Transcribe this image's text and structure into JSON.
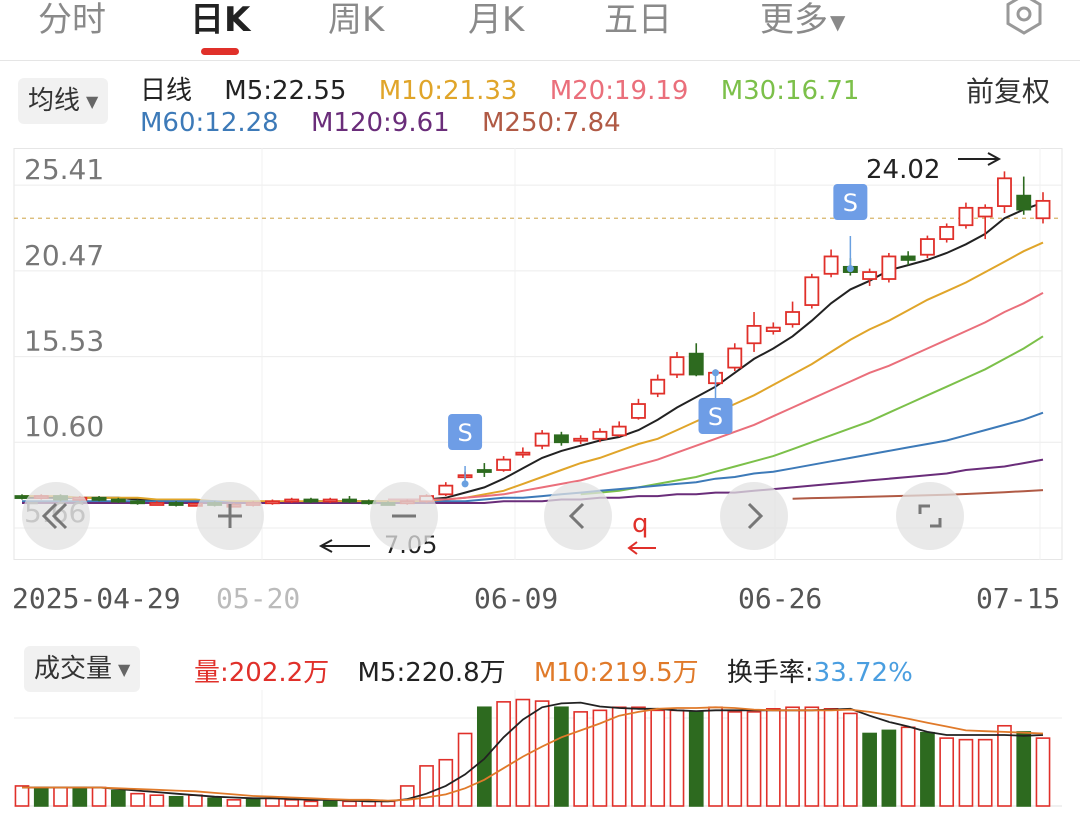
{
  "tabs": {
    "items": [
      {
        "label": "分时",
        "active": false
      },
      {
        "label": "日K",
        "active": true
      },
      {
        "label": "周K",
        "active": false
      },
      {
        "label": "月K",
        "active": false
      },
      {
        "label": "五日",
        "active": false
      },
      {
        "label": "更多",
        "active": false
      }
    ],
    "settings_icon": "gear-icon"
  },
  "ma_legend": {
    "dropdown": "均线",
    "period": "日线",
    "items": [
      {
        "label": "M5:22.55",
        "color": "#222222"
      },
      {
        "label": "M10:21.33",
        "color": "#e0a52a"
      },
      {
        "label": "M20:19.19",
        "color": "#ea6f7b"
      },
      {
        "label": "M30:16.71",
        "color": "#7cc04a"
      },
      {
        "label": "M60:12.28",
        "color": "#3d7ab8"
      },
      {
        "label": "M120:9.61",
        "color": "#6a2d7a"
      },
      {
        "label": "M250:7.84",
        "color": "#b05a45"
      }
    ],
    "adjust": "前复权"
  },
  "volume_legend": {
    "dropdown": "成交量",
    "volume_label": "量:202.2万",
    "m5_label": "M5:220.8万",
    "m10_label": "M10:219.5万",
    "turnover_label": "换手率:",
    "turnover_value": "33.72%"
  },
  "controls": [
    "rewind-icon",
    "zoom-in-icon",
    "zoom-out-icon",
    "previous-icon",
    "next-icon",
    "fullscreen-icon"
  ],
  "colors": {
    "up": "#e0302a",
    "down": "#2d6a1f",
    "accent": "#e0302a"
  },
  "chart_data": {
    "type": "candlestick",
    "ylim": [
      5.66,
      27.2
    ],
    "y_ticks": [
      "25.41",
      "20.47",
      "15.53",
      "10.60",
      "5.66"
    ],
    "x_ticks": [
      "2025-04-29",
      "05-20",
      "06-09",
      "06-26",
      "07-15"
    ],
    "max_label": "24.02",
    "min_label": "7.05",
    "markers": [
      "S",
      "S",
      "S"
    ],
    "candles": [
      [
        7.5,
        7.4,
        7.6,
        7.3
      ],
      [
        7.4,
        7.5,
        7.6,
        7.3
      ],
      [
        7.5,
        7.3,
        7.6,
        7.2
      ],
      [
        7.3,
        7.4,
        7.5,
        7.2
      ],
      [
        7.4,
        7.3,
        7.5,
        7.2
      ],
      [
        7.3,
        7.2,
        7.4,
        7.1
      ],
      [
        7.2,
        7.1,
        7.3,
        7.0
      ],
      [
        7.1,
        7.1,
        7.2,
        7.0
      ],
      [
        7.1,
        7.0,
        7.2,
        6.9
      ],
      [
        7.0,
        7.05,
        7.1,
        6.9
      ],
      [
        7.1,
        7.0,
        7.2,
        6.9
      ],
      [
        7.0,
        7.0,
        7.1,
        6.9
      ],
      [
        7.0,
        7.1,
        7.2,
        6.9
      ],
      [
        7.1,
        7.2,
        7.3,
        7.0
      ],
      [
        7.2,
        7.3,
        7.4,
        7.1
      ],
      [
        7.3,
        7.2,
        7.4,
        7.1
      ],
      [
        7.2,
        7.3,
        7.4,
        7.1
      ],
      [
        7.3,
        7.2,
        7.5,
        7.1
      ],
      [
        7.2,
        7.1,
        7.3,
        7.0
      ],
      [
        7.1,
        7.05,
        7.2,
        7.05
      ],
      [
        7.1,
        7.2,
        7.3,
        7.0
      ],
      [
        7.2,
        7.5,
        7.6,
        7.1
      ],
      [
        7.6,
        8.1,
        8.3,
        7.5
      ],
      [
        8.6,
        8.7,
        8.9,
        8.5
      ],
      [
        9.0,
        8.9,
        9.4,
        8.6
      ],
      [
        9.0,
        9.6,
        9.8,
        8.9
      ],
      [
        9.9,
        10.0,
        10.3,
        9.7
      ],
      [
        10.4,
        11.1,
        11.3,
        10.2
      ],
      [
        11.0,
        10.6,
        11.2,
        10.4
      ],
      [
        10.7,
        10.8,
        11.0,
        10.5
      ],
      [
        10.8,
        11.2,
        11.4,
        10.6
      ],
      [
        11.0,
        11.5,
        11.8,
        10.9
      ],
      [
        12.0,
        12.8,
        13.1,
        11.9
      ],
      [
        13.4,
        14.2,
        14.5,
        13.2
      ],
      [
        14.5,
        15.5,
        15.8,
        14.3
      ],
      [
        15.7,
        14.5,
        16.3,
        14.4
      ],
      [
        14.0,
        14.6,
        14.8,
        13.8
      ],
      [
        14.9,
        16.0,
        16.3,
        14.7
      ],
      [
        16.3,
        17.3,
        18.1,
        15.8
      ],
      [
        17.0,
        17.2,
        17.5,
        16.8
      ],
      [
        17.4,
        18.1,
        18.7,
        17.2
      ],
      [
        18.5,
        20.1,
        20.3,
        18.3
      ],
      [
        20.3,
        21.3,
        21.7,
        20.1
      ],
      [
        20.7,
        20.4,
        21.2,
        20.2
      ],
      [
        20.0,
        20.4,
        20.6,
        19.6
      ],
      [
        20.0,
        21.3,
        21.5,
        19.8
      ],
      [
        21.3,
        21.1,
        21.6,
        20.8
      ],
      [
        21.4,
        22.3,
        22.5,
        21.2
      ],
      [
        22.3,
        23.0,
        23.2,
        22.1
      ],
      [
        23.1,
        24.1,
        24.4,
        22.9
      ],
      [
        23.6,
        24.1,
        24.3,
        22.3
      ],
      [
        24.2,
        25.8,
        26.2,
        23.8
      ],
      [
        24.8,
        24.0,
        25.9,
        23.7
      ],
      [
        23.5,
        24.5,
        25.0,
        23.2
      ]
    ],
    "ma_series": [
      {
        "name": "M5",
        "color": "#222222",
        "values": [
          7.4,
          7.4,
          7.4,
          7.4,
          7.4,
          7.4,
          7.3,
          7.3,
          7.2,
          7.2,
          7.1,
          7.1,
          7.1,
          7.1,
          7.1,
          7.2,
          7.2,
          7.2,
          7.2,
          7.2,
          7.2,
          7.3,
          7.4,
          7.7,
          8.0,
          8.5,
          9.1,
          9.7,
          10.1,
          10.4,
          10.7,
          10.9,
          11.3,
          11.9,
          12.6,
          13.2,
          13.8,
          14.6,
          15.4,
          16.0,
          16.7,
          17.6,
          18.6,
          19.4,
          19.9,
          20.5,
          20.8,
          21.1,
          21.5,
          22.0,
          22.6,
          23.5,
          24.0,
          24.4
        ]
      },
      {
        "name": "M10",
        "color": "#e0a52a",
        "values": [
          7.5,
          7.5,
          7.5,
          7.4,
          7.4,
          7.4,
          7.4,
          7.3,
          7.3,
          7.3,
          7.2,
          7.2,
          7.2,
          7.2,
          7.2,
          7.2,
          7.2,
          7.2,
          7.2,
          7.2,
          7.2,
          7.2,
          7.3,
          7.4,
          7.6,
          7.8,
          8.2,
          8.6,
          9.0,
          9.4,
          9.7,
          10.1,
          10.5,
          10.8,
          11.3,
          11.8,
          12.3,
          12.8,
          13.3,
          13.9,
          14.5,
          15.1,
          15.8,
          16.5,
          17.1,
          17.6,
          18.2,
          18.8,
          19.3,
          19.8,
          20.4,
          21.0,
          21.6,
          22.1
        ]
      },
      {
        "name": "M20",
        "color": "#ea6f7b",
        "values": [
          null,
          null,
          null,
          null,
          null,
          null,
          null,
          null,
          null,
          null,
          null,
          null,
          null,
          null,
          null,
          null,
          null,
          null,
          null,
          7.3,
          7.3,
          7.3,
          7.3,
          7.4,
          7.5,
          7.6,
          7.8,
          8.0,
          8.2,
          8.4,
          8.7,
          9.0,
          9.3,
          9.6,
          10.0,
          10.4,
          10.8,
          11.2,
          11.6,
          12.1,
          12.6,
          13.1,
          13.6,
          14.1,
          14.6,
          15.0,
          15.5,
          16.0,
          16.5,
          17.0,
          17.5,
          18.1,
          18.6,
          19.2
        ]
      },
      {
        "name": "M30",
        "color": "#7cc04a",
        "values": [
          null,
          null,
          null,
          null,
          null,
          null,
          null,
          null,
          null,
          null,
          null,
          null,
          null,
          null,
          null,
          null,
          null,
          null,
          null,
          null,
          null,
          null,
          null,
          null,
          null,
          null,
          null,
          null,
          null,
          7.6,
          7.7,
          7.8,
          8.0,
          8.2,
          8.4,
          8.6,
          8.9,
          9.2,
          9.5,
          9.8,
          10.2,
          10.6,
          11.0,
          11.4,
          11.8,
          12.3,
          12.8,
          13.3,
          13.8,
          14.3,
          14.8,
          15.4,
          16.0,
          16.7
        ]
      },
      {
        "name": "M60",
        "color": "#3d7ab8",
        "values": [
          7.2,
          7.2,
          7.2,
          7.2,
          7.2,
          7.2,
          7.2,
          7.2,
          7.2,
          7.2,
          7.2,
          7.1,
          7.1,
          7.1,
          7.1,
          7.1,
          7.1,
          7.1,
          7.1,
          7.1,
          7.1,
          7.1,
          7.2,
          7.2,
          7.3,
          7.4,
          7.4,
          7.5,
          7.6,
          7.7,
          7.8,
          7.9,
          8.0,
          8.1,
          8.2,
          8.3,
          8.5,
          8.6,
          8.8,
          8.9,
          9.1,
          9.3,
          9.5,
          9.7,
          9.9,
          10.1,
          10.3,
          10.5,
          10.7,
          11.0,
          11.3,
          11.6,
          11.9,
          12.3
        ]
      },
      {
        "name": "M120",
        "color": "#6a2d7a",
        "values": [
          7.1,
          7.1,
          7.1,
          7.1,
          7.1,
          7.1,
          7.1,
          7.1,
          7.1,
          7.1,
          7.1,
          7.1,
          7.1,
          7.1,
          7.1,
          7.1,
          7.1,
          7.1,
          7.1,
          7.1,
          7.1,
          7.1,
          7.1,
          7.1,
          7.1,
          7.2,
          7.2,
          7.2,
          7.3,
          7.3,
          7.4,
          7.4,
          7.5,
          7.5,
          7.6,
          7.6,
          7.7,
          7.7,
          7.8,
          7.9,
          8.0,
          8.1,
          8.2,
          8.3,
          8.4,
          8.5,
          8.6,
          8.7,
          8.8,
          9.0,
          9.1,
          9.2,
          9.4,
          9.6
        ]
      },
      {
        "name": "M250",
        "color": "#b05a45",
        "values": [
          null,
          null,
          null,
          null,
          null,
          null,
          null,
          null,
          null,
          null,
          null,
          null,
          null,
          null,
          null,
          null,
          null,
          null,
          null,
          null,
          null,
          null,
          null,
          null,
          null,
          null,
          null,
          null,
          null,
          null,
          null,
          null,
          null,
          null,
          null,
          null,
          null,
          null,
          null,
          null,
          7.35,
          7.38,
          7.4,
          7.43,
          7.46,
          7.49,
          7.52,
          7.55,
          7.58,
          7.62,
          7.67,
          7.72,
          7.78,
          7.84
        ]
      }
    ],
    "volume": {
      "values": [
        26,
        24,
        24,
        24,
        24,
        20,
        16,
        14,
        12,
        14,
        10,
        8,
        10,
        10,
        8,
        6,
        6,
        6,
        6,
        6,
        26,
        52,
        60,
        94,
        128,
        135,
        138,
        136,
        128,
        122,
        124,
        128,
        128,
        124,
        124,
        122,
        128,
        122,
        122,
        126,
        128,
        128,
        126,
        120,
        94,
        98,
        102,
        95,
        88,
        86,
        86,
        104,
        96,
        88
      ],
      "up": [
        true,
        false,
        true,
        false,
        true,
        false,
        true,
        true,
        false,
        true,
        false,
        true,
        false,
        true,
        true,
        true,
        false,
        true,
        true,
        true,
        true,
        true,
        true,
        true,
        false,
        true,
        true,
        true,
        false,
        true,
        true,
        true,
        true,
        true,
        true,
        false,
        true,
        true,
        true,
        true,
        true,
        true,
        true,
        true,
        false,
        false,
        true,
        false,
        true,
        true,
        true,
        true,
        false,
        true
      ],
      "m5": [
        24,
        24,
        24,
        24,
        24,
        22,
        20,
        18,
        16,
        14,
        12,
        11,
        10,
        10,
        9,
        8,
        8,
        7,
        6,
        6,
        9,
        16,
        26,
        41,
        61,
        89,
        112,
        128,
        133,
        134,
        129,
        127,
        126,
        126,
        124,
        123,
        124,
        124,
        124,
        124,
        124,
        124,
        125,
        126,
        117,
        109,
        103,
        96,
        92,
        92,
        92,
        92,
        91,
        92
      ],
      "m10": [
        24,
        24,
        24,
        24,
        24,
        23,
        22,
        21,
        20,
        19,
        17,
        15,
        13,
        12,
        11,
        10,
        9,
        8,
        8,
        7,
        8,
        11,
        15,
        23,
        34,
        49,
        64,
        77,
        89,
        98,
        107,
        117,
        122,
        126,
        127,
        127,
        128,
        127,
        125,
        124,
        124,
        124,
        124,
        125,
        122,
        118,
        113,
        108,
        103,
        98,
        97,
        96,
        95,
        94
      ]
    }
  }
}
